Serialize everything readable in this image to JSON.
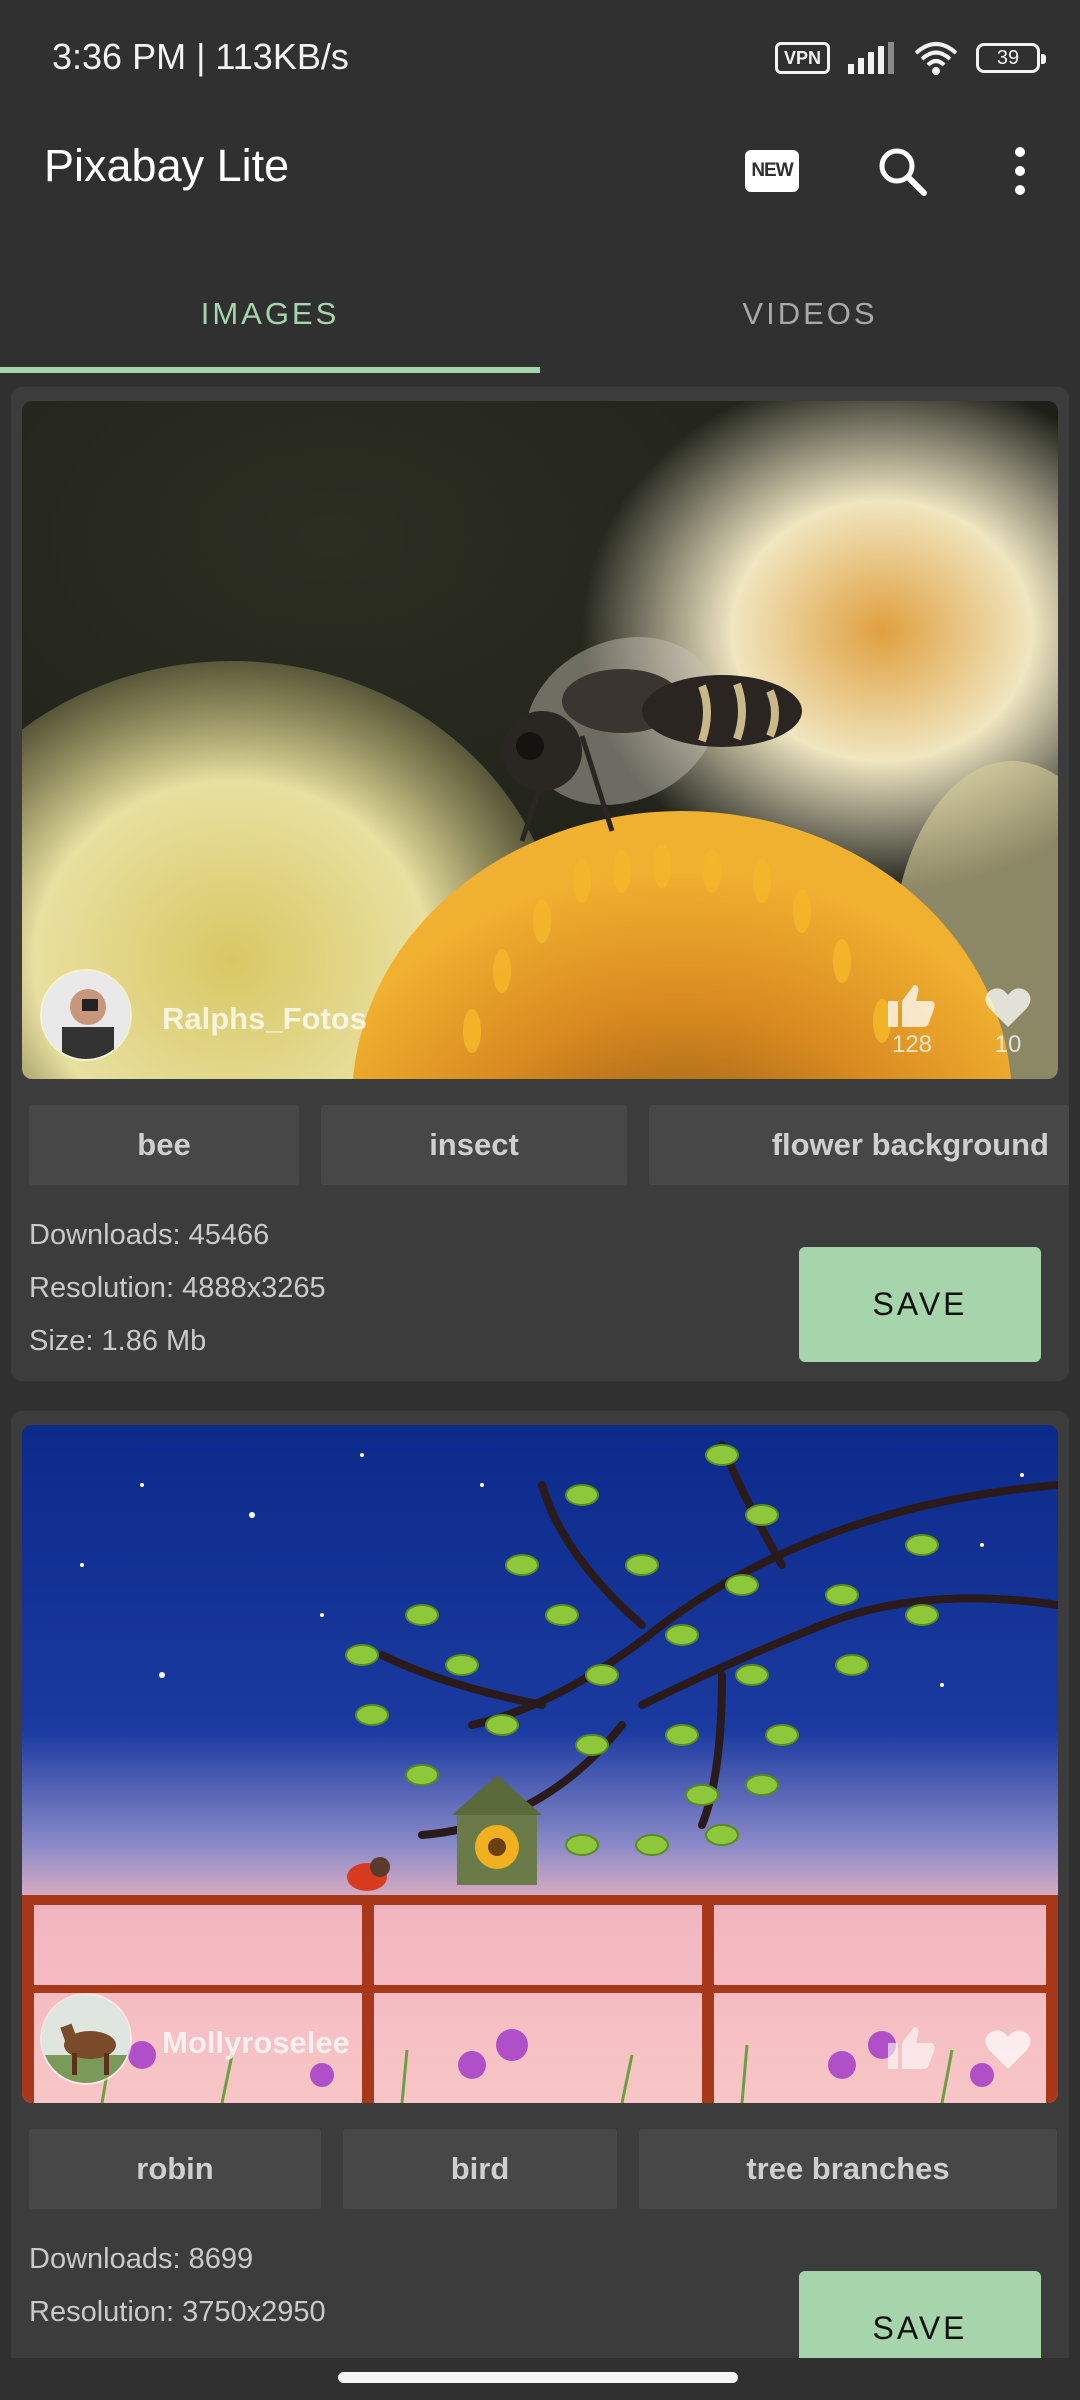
{
  "status_bar": {
    "time_speed": "3:36 PM | 113KB/s",
    "vpn": "VPN",
    "battery": "39",
    "icons": [
      "vpn-icon",
      "signal-icon",
      "wifi-icon",
      "battery-icon"
    ]
  },
  "app_bar": {
    "title": "Pixabay Lite",
    "new_badge": "NEW",
    "icons": [
      "new-icon",
      "search-icon",
      "more-vert-icon"
    ]
  },
  "tabs": [
    {
      "label": "IMAGES",
      "active": true
    },
    {
      "label": "VIDEOS",
      "active": false
    }
  ],
  "colors": {
    "accent": "#a6d4ab",
    "background": "#303030",
    "card": "#3c3c3c",
    "tag": "#474747"
  },
  "cards": [
    {
      "author": "Ralphs_Fotos",
      "likes": "128",
      "favorites": "10",
      "tags": [
        "bee",
        "insect",
        "flower background"
      ],
      "downloads": "Downloads: 45466",
      "resolution": "Resolution: 4888x3265",
      "size": "Size: 1.86 Mb",
      "save_label": "SAVE"
    },
    {
      "author": "Mollyroselee",
      "tags": [
        "robin",
        "bird",
        "tree branches"
      ],
      "downloads": "Downloads: 8699",
      "resolution": "Resolution: 3750x2950",
      "save_label": "SAVE"
    }
  ]
}
